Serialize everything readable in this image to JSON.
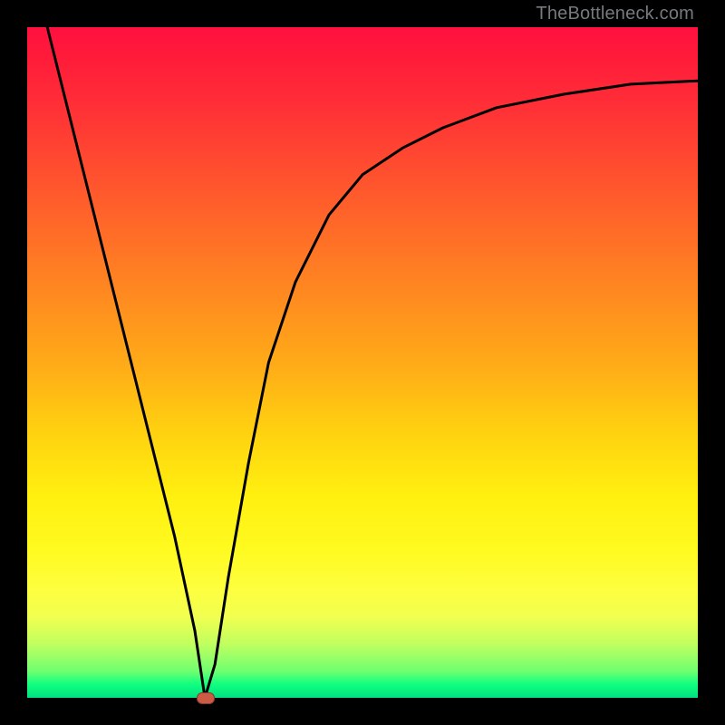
{
  "watermark": "TheBottleneck.com",
  "chart_data": {
    "type": "line",
    "title": "",
    "xlabel": "",
    "ylabel": "",
    "xlim": [
      0,
      100
    ],
    "ylim": [
      0,
      100
    ],
    "series": [
      {
        "name": "bottleneck-curve",
        "x": [
          3,
          5,
          8,
          12,
          16,
          19,
          22,
          25,
          26.5,
          28,
          30,
          33,
          36,
          40,
          45,
          50,
          56,
          62,
          70,
          80,
          90,
          100
        ],
        "y": [
          100,
          92,
          80,
          64,
          48,
          36,
          24,
          10,
          0,
          5,
          18,
          35,
          50,
          62,
          72,
          78,
          82,
          85,
          88,
          90,
          91.5,
          92
        ]
      }
    ],
    "marker": {
      "x": 26.5,
      "y": 0
    }
  },
  "colors": {
    "background_frame": "#000000",
    "gradient_top": "#ff1040",
    "gradient_bottom": "#00e080",
    "curve": "#000000",
    "marker_fill": "#cc5a45"
  }
}
